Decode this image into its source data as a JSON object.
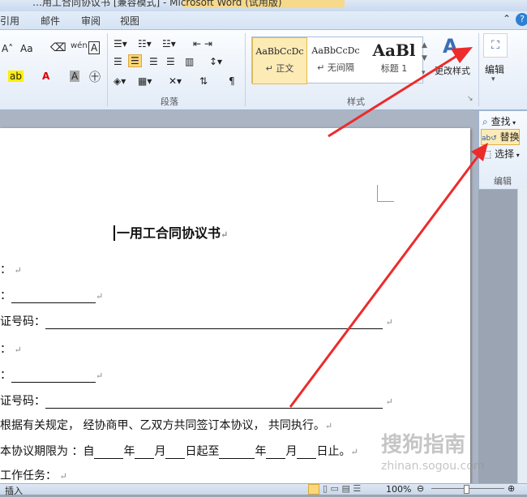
{
  "window": {
    "title": "…用工合同协议书 [兼容模式] - Microsoft Word (试用版)"
  },
  "tabs": [
    "引用",
    "邮件",
    "审阅",
    "视图"
  ],
  "ribbon": {
    "font_glyphs": {
      "size_inc": "A˄",
      "aa": "Aa",
      "pinyin": "wén",
      "char_border": "A"
    },
    "styles": [
      {
        "sample": "AaBbCcDc",
        "name": "↵ 正文"
      },
      {
        "sample": "AaBbCcDc",
        "name": "↵ 无间隔"
      },
      {
        "sample": "AaBl",
        "name": "标题 1"
      }
    ],
    "change_styles": "更改样式",
    "edit_big": "编辑",
    "group_paragraph": "段落",
    "group_styles": "样式"
  },
  "side_panel": {
    "find": "查找",
    "replace": "替换",
    "select": "选择",
    "group": "编辑"
  },
  "document": {
    "title": "一用工合同协议书",
    "lines": [
      {
        "prefix": "：",
        "blank": "",
        "suffix": ""
      },
      {
        "prefix": "：",
        "blank": "",
        "suffix": ""
      },
      {
        "prefix": "证号码：",
        "blank": "",
        "suffix": ""
      },
      {
        "prefix": "：",
        "blank": "",
        "suffix": ""
      },
      {
        "prefix": "：",
        "blank": "",
        "suffix": ""
      },
      {
        "prefix": "证号码：",
        "blank": "",
        "suffix": ""
      }
    ],
    "clause1": "根据有关规定， 经协商甲、乙双方共同签订本协议， 共同执行。",
    "clause2_a": "本协议期限为 ：自",
    "clause2_year1": "年",
    "clause2_month1": "月",
    "clause2_day1": "日起至",
    "clause2_year2": "年",
    "clause2_month2": "月",
    "clause2_day2": "日止。",
    "clause3": "工作任务："
  },
  "status": {
    "mode": "插入",
    "zoom": "100%"
  },
  "watermark": {
    "text": "搜狗指南",
    "url": "zhinan.sogou.com"
  },
  "colors": {
    "arrow": "#ec2b2b",
    "highlight": "#fdebb6"
  }
}
